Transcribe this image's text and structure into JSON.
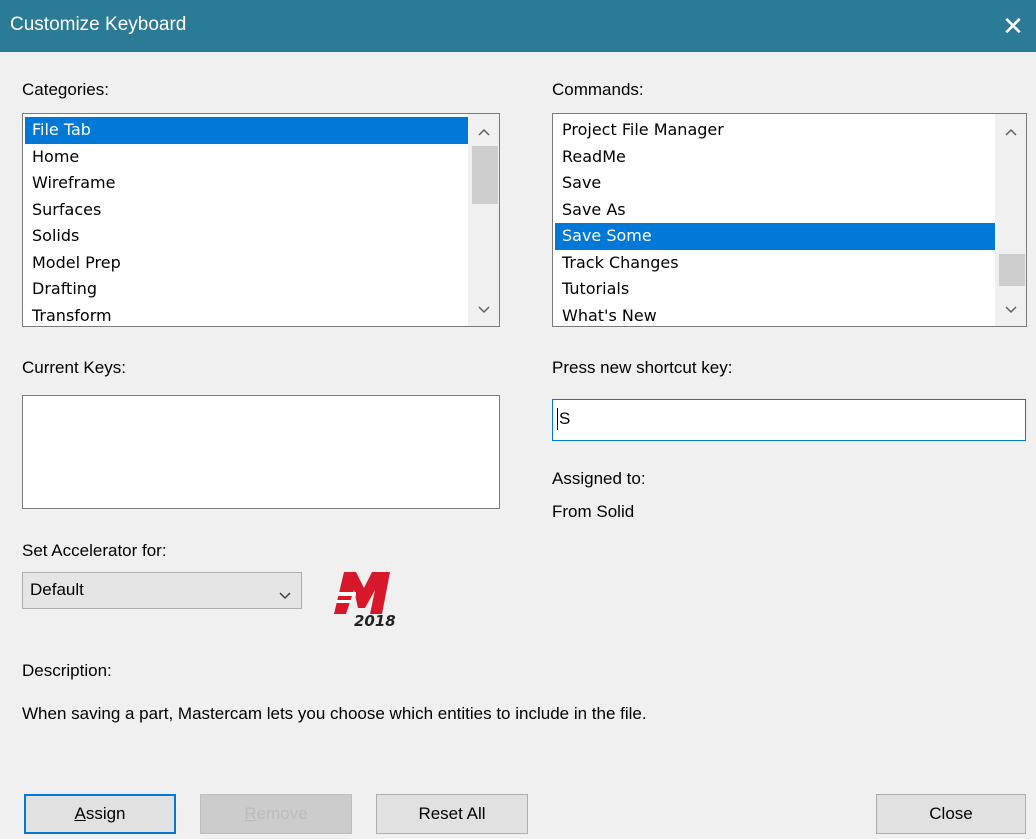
{
  "window": {
    "title": "Customize Keyboard",
    "close_glyph": "✕"
  },
  "categories": {
    "label": "Categories:",
    "items": [
      "File Tab",
      "Home",
      "Wireframe",
      "Surfaces",
      "Solids",
      "Model Prep",
      "Drafting",
      "Transform"
    ],
    "selected": "File Tab"
  },
  "commands": {
    "label": "Commands:",
    "items": [
      "Project File Manager",
      "ReadMe",
      "Save",
      "Save As",
      "Save Some",
      "Track Changes",
      "Tutorials",
      "What's New"
    ],
    "selected": "Save Some"
  },
  "current_keys": {
    "label": "Current Keys:"
  },
  "shortcut": {
    "label": "Press new shortcut key:",
    "value": "S"
  },
  "assigned": {
    "label": "Assigned to:",
    "value": "From Solid"
  },
  "accelerator": {
    "label": "Set Accelerator for:",
    "value": "Default"
  },
  "logo": {
    "year": "2018",
    "accent_color": "#d7182a"
  },
  "description": {
    "label": "Description:",
    "text": "When saving a part, Mastercam lets you choose which entities to include in the file."
  },
  "buttons": {
    "assign": {
      "accel": "A",
      "rest": "ssign"
    },
    "remove": {
      "accel": "R",
      "rest": "emove"
    },
    "reset_all": "Reset All",
    "close": "Close"
  },
  "colors": {
    "titlebar": "#2b7a96",
    "selection": "#0078d7"
  }
}
